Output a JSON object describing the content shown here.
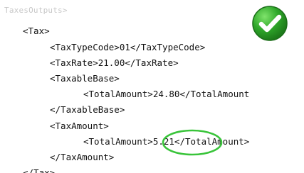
{
  "header": {
    "faded_text": "TaxesOutputs>"
  },
  "code_lines": {
    "tax_open": "<Tax>",
    "tax_type_code": "<TaxTypeCode>01</TaxTypeCode>",
    "tax_rate": "<TaxRate>21.00</TaxRate>",
    "taxable_base_open": "<TaxableBase>",
    "taxable_base_total": "<TotalAmount>24.80</TotalAmount",
    "taxable_base_close": "</TaxableBase>",
    "tax_amount_open": "<TaxAmount>",
    "tax_amount_total": "<TotalAmount>5.21</TotalAmount>",
    "tax_amount_close": "</TaxAmount>",
    "tax_close": "</Tax>"
  },
  "icons": {
    "badge": "check-badge-icon",
    "ring": "highlight-circle"
  },
  "colors": {
    "check_green": "#2fa82a",
    "check_green_dark": "#1d7a1a",
    "ring_green": "#39c43a",
    "faded_text": "#c8c8c8"
  }
}
